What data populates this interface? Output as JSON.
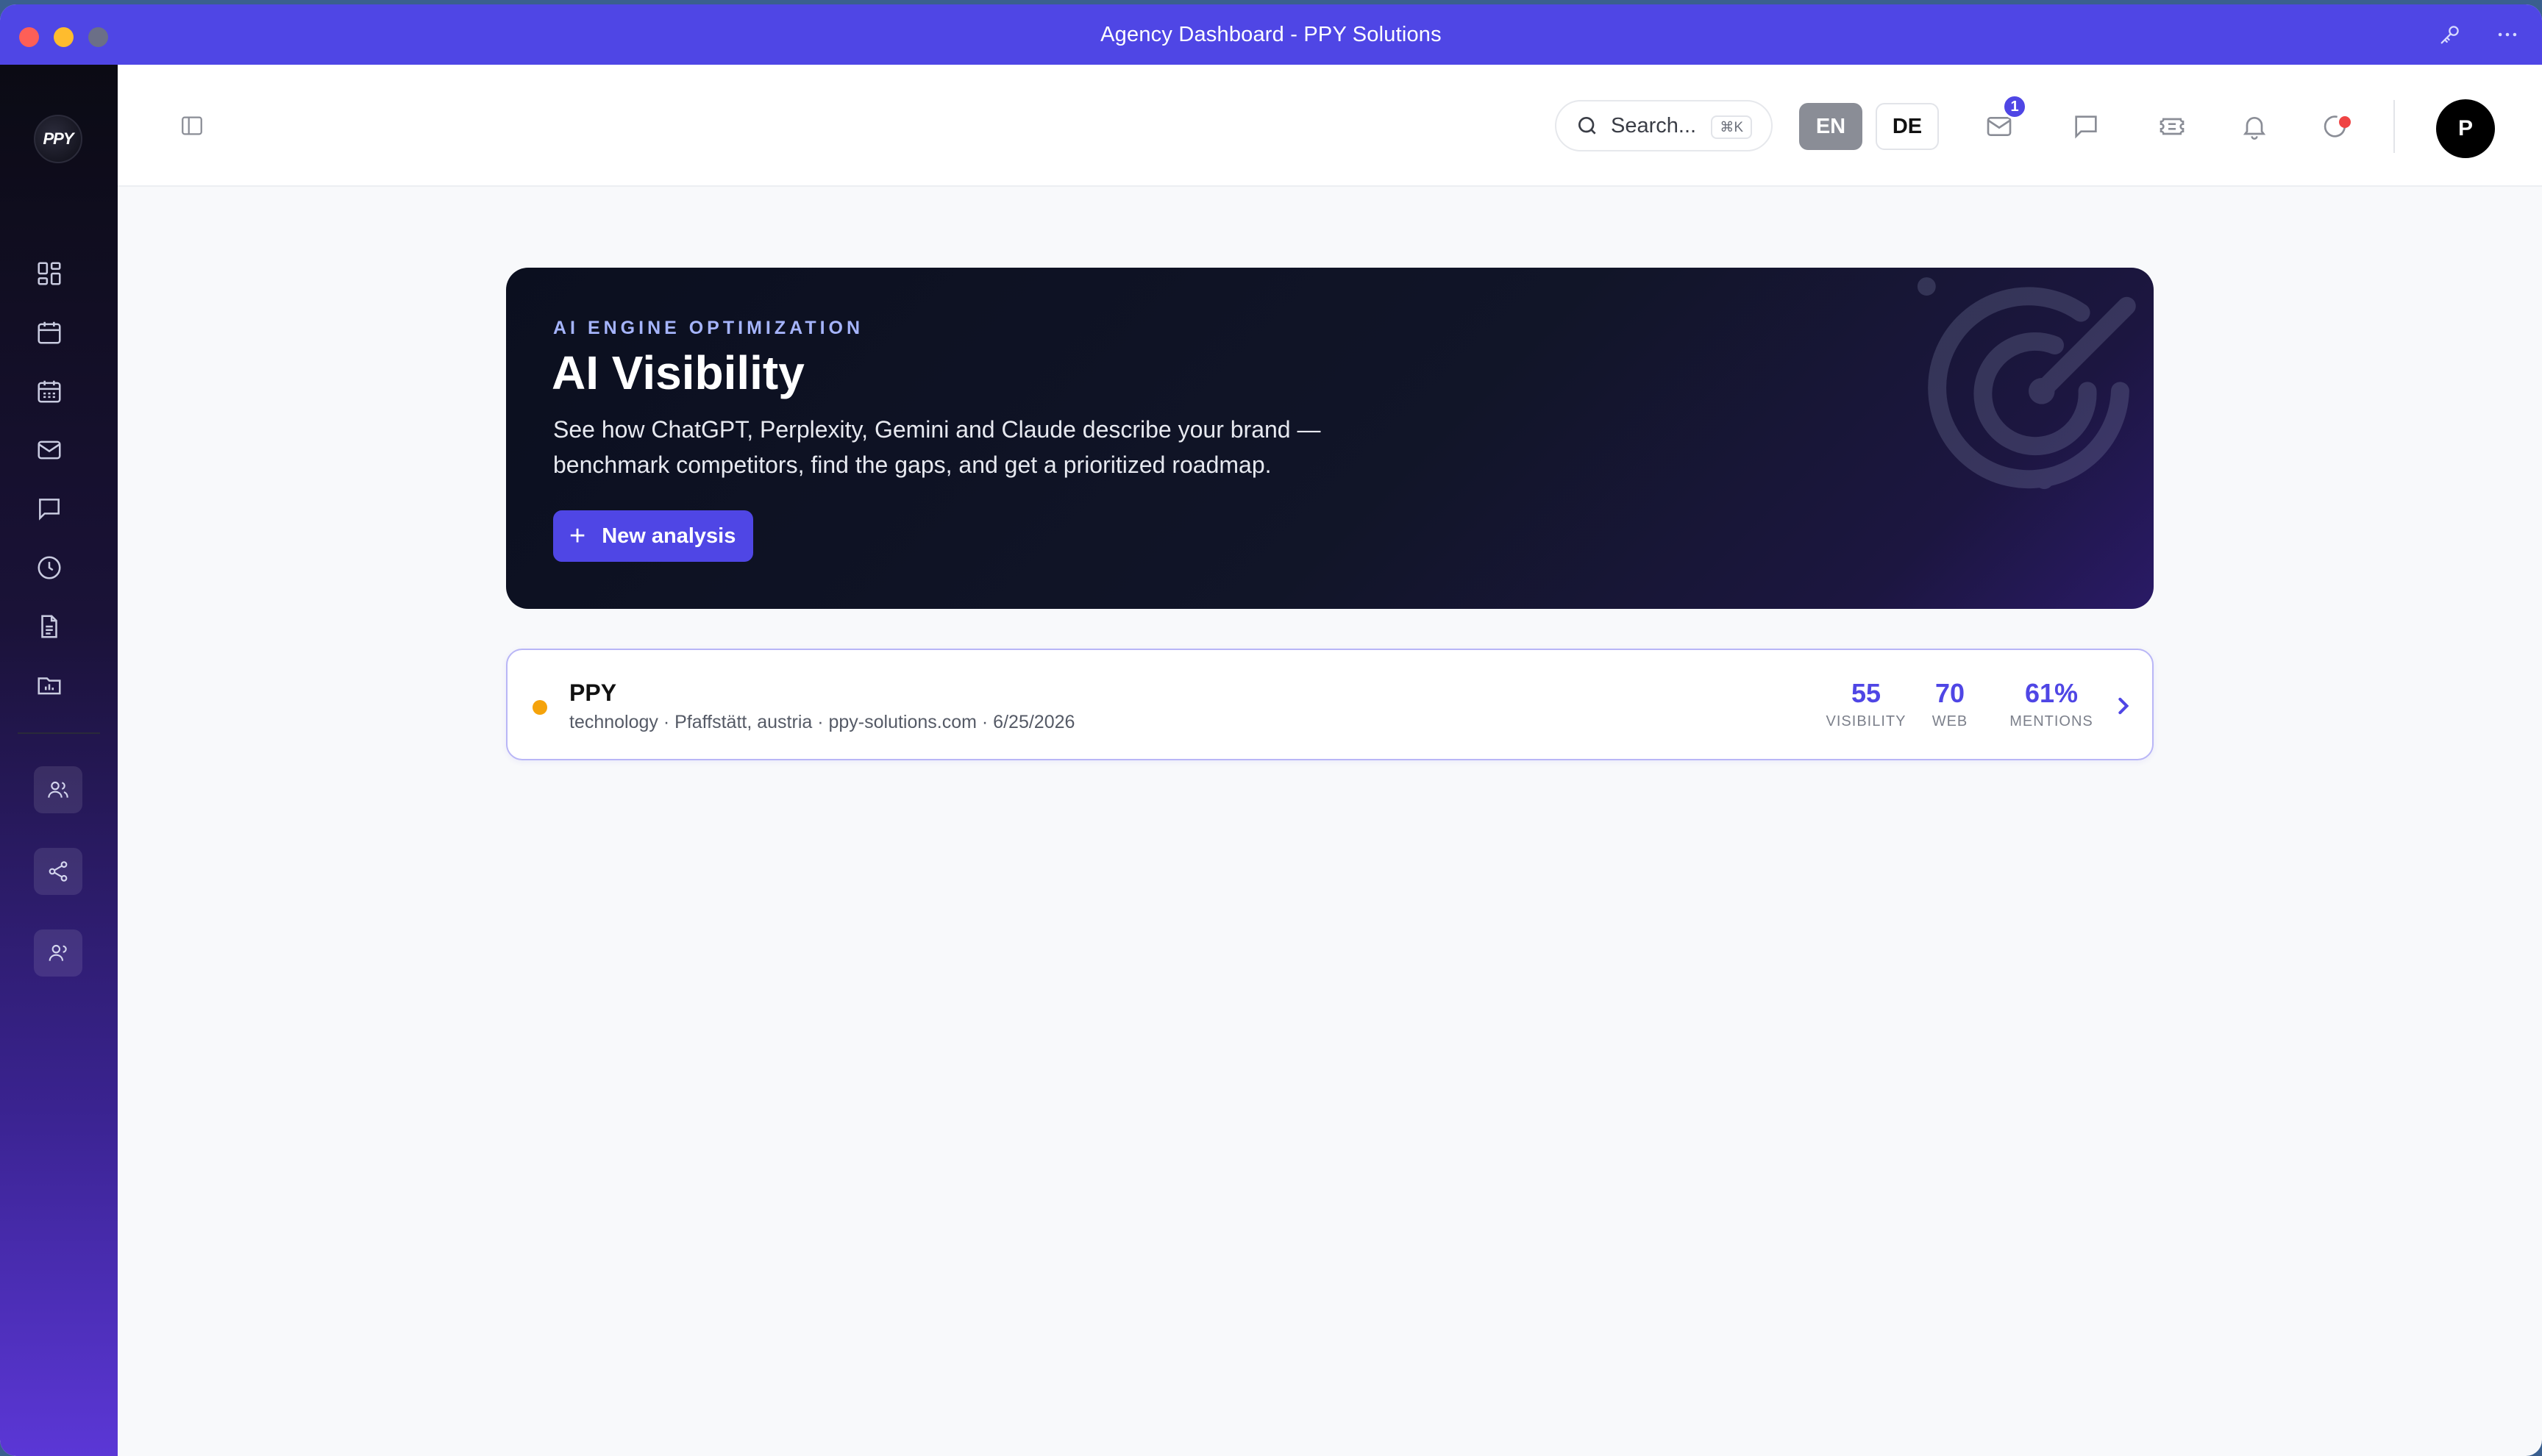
{
  "window": {
    "title": "Agency Dashboard - PPY Solutions"
  },
  "sidebar": {
    "logo_text": "PPY",
    "nav": [
      "grid-icon",
      "calendar-icon",
      "calendar-grid-icon",
      "mail-icon",
      "chat-icon",
      "clock-icon",
      "document-icon",
      "folder-chart-icon"
    ],
    "bottom": [
      "users-icon",
      "share-icon",
      "contacts-icon"
    ]
  },
  "header": {
    "search_placeholder": "Search...",
    "search_shortcut": "⌘K",
    "lang_en": "EN",
    "lang_de": "DE",
    "mail_badge": "1",
    "avatar_initial": "P"
  },
  "hero": {
    "kicker": "AI ENGINE OPTIMIZATION",
    "title": "AI Visibility",
    "description": "See how ChatGPT, Perplexity, Gemini and Claude describe your brand — benchmark competitors, find the gaps, and get a prioritized roadmap.",
    "button_label": "New analysis"
  },
  "analysis": {
    "name": "PPY",
    "meta": "technology · Pfaffstätt, austria · ppy-solutions.com · 6/25/2026",
    "status_color": "#f5a30b",
    "metrics": [
      {
        "value": "55",
        "label": "VISIBILITY"
      },
      {
        "value": "70",
        "label": "WEB"
      },
      {
        "value": "61%",
        "label": "MENTIONS"
      }
    ]
  },
  "colors": {
    "accent": "#4f46e5",
    "titlebar": "#4f46e5",
    "hero_bg": "#0b0f1f"
  }
}
